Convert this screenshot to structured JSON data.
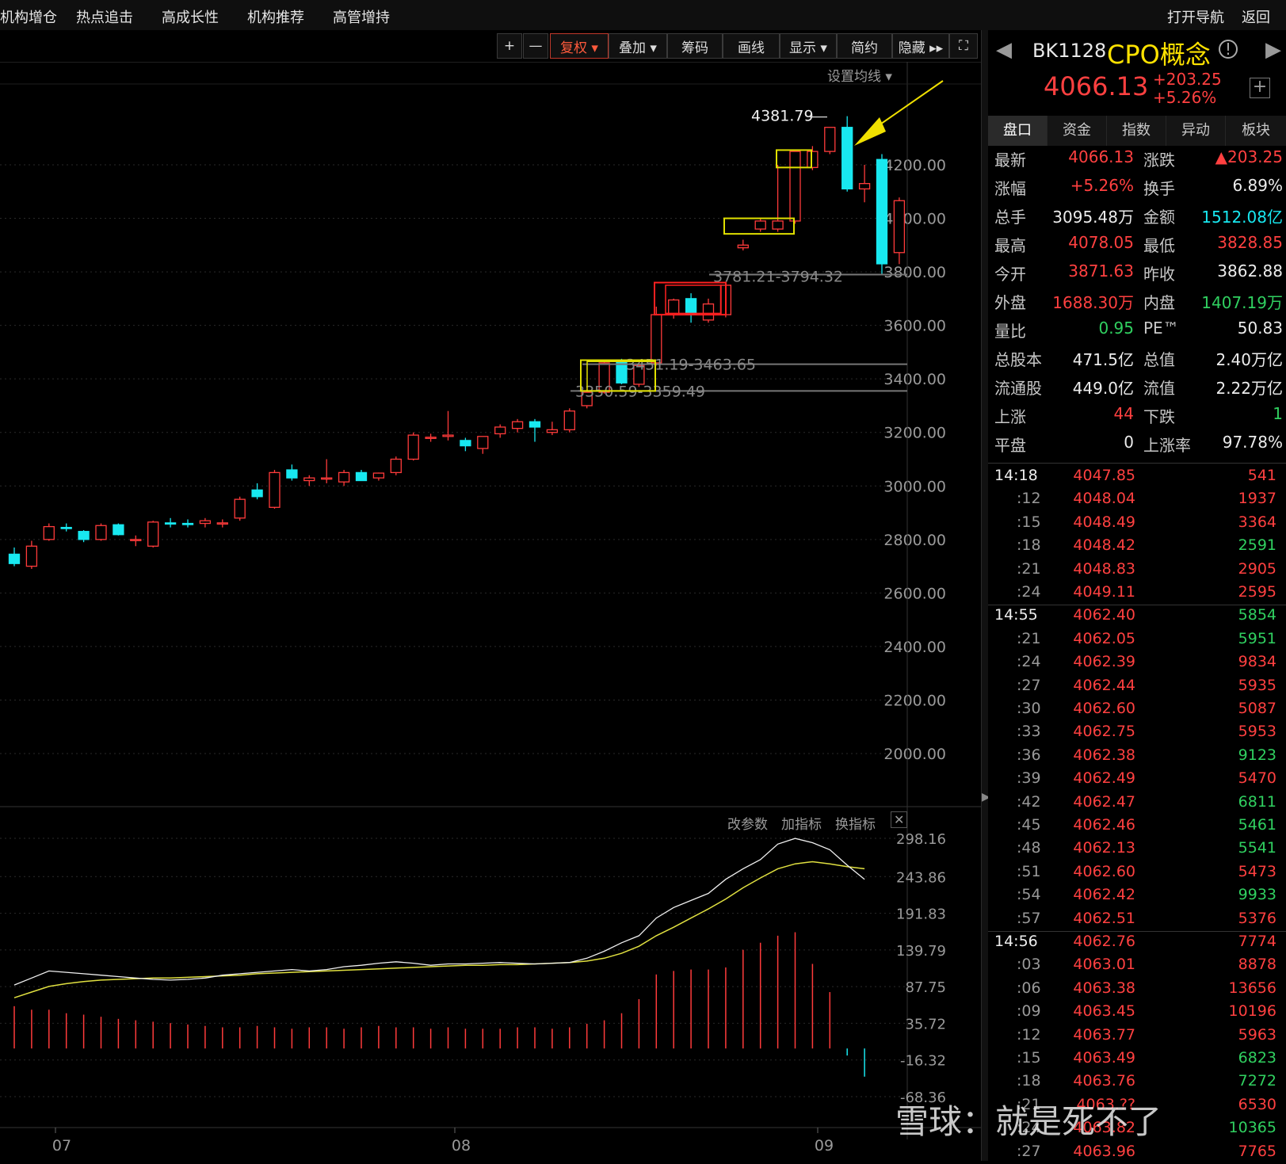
{
  "topnav": {
    "left_items": [
      "机构增仓",
      "热点追击",
      "高成长性",
      "机构推荐",
      "高管增持"
    ],
    "right_items": [
      "打开导航",
      "返回"
    ]
  },
  "toolbar": {
    "plus": "+",
    "minus": "—",
    "buttons": [
      "复权 ▾",
      "叠加 ▾",
      "筹码",
      "画线",
      "显示 ▾",
      "简约",
      "隐藏 ▸▸",
      "⛶"
    ]
  },
  "main_chart": {
    "set_ma_label": "设置均线 ▾",
    "high_label": "4381.79",
    "price_axis": [
      "4200.00",
      "4000.00",
      "3800.00",
      "3600.00",
      "3400.00",
      "3200.00",
      "3000.00",
      "2800.00",
      "2600.00",
      "2400.00",
      "2200.00",
      "2000.00"
    ],
    "range_labels": [
      "3781.21-3794.32",
      "3451.19-3463.65",
      "3350.59-3359.49"
    ],
    "x_labels": [
      "07",
      "08",
      "09"
    ]
  },
  "indicator": {
    "buttons": [
      "改参数",
      "加指标",
      "换指标"
    ],
    "close": "✕",
    "axis": [
      "298.16",
      "243.86",
      "191.83",
      "139.79",
      "87.75",
      "35.72",
      "-16.32",
      "-68.36"
    ]
  },
  "quote": {
    "code": "BK1128",
    "name": "CPO概念",
    "price": "4066.13",
    "change": "+203.25",
    "change_pct": "+5.26%",
    "tabs": [
      "盘口",
      "资金",
      "指数",
      "异动",
      "板块"
    ],
    "rows": [
      {
        "l1": "最新",
        "v1": "4066.13",
        "c1": "red",
        "l2": "涨跌",
        "v2": "▲203.25",
        "c2": "red"
      },
      {
        "l1": "涨幅",
        "v1": "+5.26%",
        "c1": "red",
        "l2": "换手",
        "v2": "6.89%",
        "c2": "white"
      },
      {
        "l1": "总手",
        "v1": "3095.48万",
        "c1": "white",
        "l2": "金额",
        "v2": "1512.08亿",
        "c2": "cyan"
      },
      {
        "l1": "最高",
        "v1": "4078.05",
        "c1": "red",
        "l2": "最低",
        "v2": "3828.85",
        "c2": "red"
      },
      {
        "l1": "今开",
        "v1": "3871.63",
        "c1": "red",
        "l2": "昨收",
        "v2": "3862.88",
        "c2": "white"
      },
      {
        "l1": "外盘",
        "v1": "1688.30万",
        "c1": "red",
        "l2": "内盘",
        "v2": "1407.19万",
        "c2": "green"
      },
      {
        "l1": "量比",
        "v1": "0.95",
        "c1": "green",
        "l2": "PE™",
        "v2": "50.83",
        "c2": "white"
      },
      {
        "l1": "总股本",
        "v1": "471.5亿",
        "c1": "white",
        "l2": "总值",
        "v2": "2.40万亿",
        "c2": "white"
      },
      {
        "l1": "流通股",
        "v1": "449.0亿",
        "c1": "white",
        "l2": "流值",
        "v2": "2.22万亿",
        "c2": "white"
      },
      {
        "l1": "上涨",
        "v1": "44",
        "c1": "red",
        "l2": "下跌",
        "v2": "1",
        "c2": "green"
      },
      {
        "l1": "平盘",
        "v1": "0",
        "c1": "white",
        "l2": "上涨率",
        "v2": "97.78%",
        "c2": "white"
      }
    ],
    "ticks": [
      {
        "t": "14:18",
        "p": "4047.85",
        "v": "541",
        "vc": "red",
        "big": true
      },
      {
        "t": ":12",
        "p": "4048.04",
        "v": "1937",
        "vc": "red"
      },
      {
        "t": ":15",
        "p": "4048.49",
        "v": "3364",
        "vc": "red"
      },
      {
        "t": ":18",
        "p": "4048.42",
        "v": "2591",
        "vc": "green"
      },
      {
        "t": ":21",
        "p": "4048.83",
        "v": "2905",
        "vc": "red"
      },
      {
        "t": ":24",
        "p": "4049.11",
        "v": "2595",
        "vc": "red"
      },
      {
        "t": "14:55",
        "p": "4062.40",
        "v": "5854",
        "vc": "green",
        "big": true,
        "sep": true
      },
      {
        "t": ":21",
        "p": "4062.05",
        "v": "5951",
        "vc": "green"
      },
      {
        "t": ":24",
        "p": "4062.39",
        "v": "9834",
        "vc": "red"
      },
      {
        "t": ":27",
        "p": "4062.44",
        "v": "5935",
        "vc": "red"
      },
      {
        "t": ":30",
        "p": "4062.60",
        "v": "5087",
        "vc": "red"
      },
      {
        "t": ":33",
        "p": "4062.75",
        "v": "5953",
        "vc": "red"
      },
      {
        "t": ":36",
        "p": "4062.38",
        "v": "9123",
        "vc": "green"
      },
      {
        "t": ":39",
        "p": "4062.49",
        "v": "5470",
        "vc": "red"
      },
      {
        "t": ":42",
        "p": "4062.47",
        "v": "6811",
        "vc": "green"
      },
      {
        "t": ":45",
        "p": "4062.46",
        "v": "5461",
        "vc": "green"
      },
      {
        "t": ":48",
        "p": "4062.13",
        "v": "5541",
        "vc": "green"
      },
      {
        "t": ":51",
        "p": "4062.60",
        "v": "5473",
        "vc": "red"
      },
      {
        "t": ":54",
        "p": "4062.42",
        "v": "9933",
        "vc": "green"
      },
      {
        "t": ":57",
        "p": "4062.51",
        "v": "5376",
        "vc": "red"
      },
      {
        "t": "14:56",
        "p": "4062.76",
        "v": "7774",
        "vc": "red",
        "big": true,
        "sep": true
      },
      {
        "t": ":03",
        "p": "4063.01",
        "v": "8878",
        "vc": "red"
      },
      {
        "t": ":06",
        "p": "4063.38",
        "v": "13656",
        "vc": "red"
      },
      {
        "t": ":09",
        "p": "4063.45",
        "v": "10196",
        "vc": "red"
      },
      {
        "t": ":12",
        "p": "4063.77",
        "v": "5963",
        "vc": "red"
      },
      {
        "t": ":15",
        "p": "4063.49",
        "v": "6823",
        "vc": "green"
      },
      {
        "t": ":18",
        "p": "4063.76",
        "v": "7272",
        "vc": "green"
      },
      {
        "t": ":21",
        "p": "4063.??",
        "v": "6530",
        "vc": "red"
      },
      {
        "t": ":24",
        "p": "4063.82",
        "v": "10365",
        "vc": "green"
      },
      {
        "t": ":27",
        "p": "4063.96",
        "v": "7765",
        "vc": "red"
      }
    ]
  },
  "watermark": "雪球：就是死不了",
  "chart_data": {
    "type": "candlestick",
    "series": [
      {
        "o": 2745,
        "h": 2770,
        "l": 2700,
        "c": 2710
      },
      {
        "o": 2700,
        "h": 2795,
        "l": 2690,
        "c": 2775
      },
      {
        "o": 2800,
        "h": 2860,
        "l": 2795,
        "c": 2848
      },
      {
        "o": 2845,
        "h": 2860,
        "l": 2830,
        "c": 2842
      },
      {
        "o": 2830,
        "h": 2835,
        "l": 2790,
        "c": 2800
      },
      {
        "o": 2800,
        "h": 2860,
        "l": 2795,
        "c": 2852
      },
      {
        "o": 2855,
        "h": 2860,
        "l": 2815,
        "c": 2818
      },
      {
        "o": 2800,
        "h": 2815,
        "l": 2775,
        "c": 2800
      },
      {
        "o": 2775,
        "h": 2870,
        "l": 2770,
        "c": 2865
      },
      {
        "o": 2862,
        "h": 2880,
        "l": 2845,
        "c": 2860
      },
      {
        "o": 2860,
        "h": 2875,
        "l": 2845,
        "c": 2858
      },
      {
        "o": 2860,
        "h": 2880,
        "l": 2845,
        "c": 2870
      },
      {
        "o": 2862,
        "h": 2875,
        "l": 2845,
        "c": 2862
      },
      {
        "o": 2880,
        "h": 2960,
        "l": 2870,
        "c": 2950
      },
      {
        "o": 2985,
        "h": 3010,
        "l": 2950,
        "c": 2960
      },
      {
        "o": 2920,
        "h": 3060,
        "l": 2915,
        "c": 3050
      },
      {
        "o": 3060,
        "h": 3080,
        "l": 3020,
        "c": 3030
      },
      {
        "o": 3020,
        "h": 3040,
        "l": 3000,
        "c": 3030
      },
      {
        "o": 3030,
        "h": 3100,
        "l": 3010,
        "c": 3030
      },
      {
        "o": 3015,
        "h": 3060,
        "l": 3000,
        "c": 3050
      },
      {
        "o": 3050,
        "h": 3060,
        "l": 3020,
        "c": 3020
      },
      {
        "o": 3030,
        "h": 3050,
        "l": 3020,
        "c": 3048
      },
      {
        "o": 3050,
        "h": 3110,
        "l": 3040,
        "c": 3100
      },
      {
        "o": 3100,
        "h": 3200,
        "l": 3095,
        "c": 3190
      },
      {
        "o": 3180,
        "h": 3195,
        "l": 3165,
        "c": 3182
      },
      {
        "o": 3185,
        "h": 3280,
        "l": 3170,
        "c": 3190
      },
      {
        "o": 3170,
        "h": 3180,
        "l": 3130,
        "c": 3150
      },
      {
        "o": 3140,
        "h": 3185,
        "l": 3120,
        "c": 3185
      },
      {
        "o": 3195,
        "h": 3230,
        "l": 3180,
        "c": 3220
      },
      {
        "o": 3215,
        "h": 3250,
        "l": 3200,
        "c": 3240
      },
      {
        "o": 3240,
        "h": 3250,
        "l": 3165,
        "c": 3220
      },
      {
        "o": 3200,
        "h": 3240,
        "l": 3190,
        "c": 3210
      },
      {
        "o": 3210,
        "h": 3290,
        "l": 3200,
        "c": 3280
      },
      {
        "o": 3300,
        "h": 3360,
        "l": 3290,
        "c": 3350
      },
      {
        "o": 3350,
        "h": 3470,
        "l": 3345,
        "c": 3460
      },
      {
        "o": 3470,
        "h": 3475,
        "l": 3380,
        "c": 3385
      },
      {
        "o": 3380,
        "h": 3460,
        "l": 3370,
        "c": 3450
      },
      {
        "o": 3460,
        "h": 3670,
        "l": 3450,
        "c": 3640
      },
      {
        "o": 3640,
        "h": 3700,
        "l": 3625,
        "c": 3695
      },
      {
        "o": 3700,
        "h": 3720,
        "l": 3610,
        "c": 3640
      },
      {
        "o": 3620,
        "h": 3700,
        "l": 3610,
        "c": 3680
      },
      {
        "o": 3640,
        "h": 3760,
        "l": 3630,
        "c": 3750
      },
      {
        "o": 3890,
        "h": 3920,
        "l": 3880,
        "c": 3900
      },
      {
        "o": 3960,
        "h": 4000,
        "l": 3950,
        "c": 3990
      },
      {
        "o": 3960,
        "h": 4200,
        "l": 3950,
        "c": 3990
      },
      {
        "o": 3990,
        "h": 4250,
        "l": 3980,
        "c": 4250
      },
      {
        "o": 4190,
        "h": 4270,
        "l": 4180,
        "c": 4250
      },
      {
        "o": 4250,
        "h": 4340,
        "l": 4240,
        "c": 4340
      },
      {
        "o": 4340,
        "h": 4381.79,
        "l": 4100,
        "c": 4110
      },
      {
        "o": 4110,
        "h": 4200,
        "l": 4060,
        "c": 4130
      },
      {
        "o": 4220,
        "h": 4240,
        "l": 3790,
        "c": 3830
      },
      {
        "o": 3872,
        "h": 4078,
        "l": 3829,
        "c": 4066
      }
    ],
    "indicator": {
      "line1": [
        90,
        100,
        110,
        108,
        106,
        104,
        102,
        100,
        98,
        97,
        98,
        100,
        104,
        106,
        108,
        110,
        112,
        110,
        112,
        116,
        118,
        121,
        123,
        121,
        118,
        120,
        120,
        121,
        122,
        121,
        120,
        121,
        122,
        128,
        138,
        150,
        160,
        185,
        200,
        210,
        220,
        240,
        255,
        268,
        290,
        298,
        292,
        282,
        260,
        240
      ],
      "line2": [
        72,
        80,
        88,
        92,
        95,
        97,
        98,
        99,
        100,
        100,
        101,
        102,
        103,
        104,
        106,
        107,
        108,
        109,
        110,
        111,
        112,
        113,
        114,
        115,
        116,
        117,
        118,
        118,
        119,
        119,
        120,
        121,
        122,
        124,
        128,
        135,
        145,
        160,
        172,
        185,
        198,
        212,
        228,
        242,
        255,
        262,
        265,
        262,
        258,
        255
      ],
      "bars": [
        60,
        55,
        55,
        50,
        48,
        45,
        42,
        40,
        38,
        36,
        34,
        32,
        30,
        30,
        32,
        30,
        28,
        30,
        30,
        28,
        30,
        32,
        30,
        30,
        28,
        30,
        28,
        28,
        28,
        30,
        30,
        28,
        30,
        35,
        40,
        50,
        70,
        105,
        110,
        112,
        112,
        115,
        140,
        150,
        160,
        165,
        120,
        80,
        -10,
        -40
      ]
    }
  }
}
